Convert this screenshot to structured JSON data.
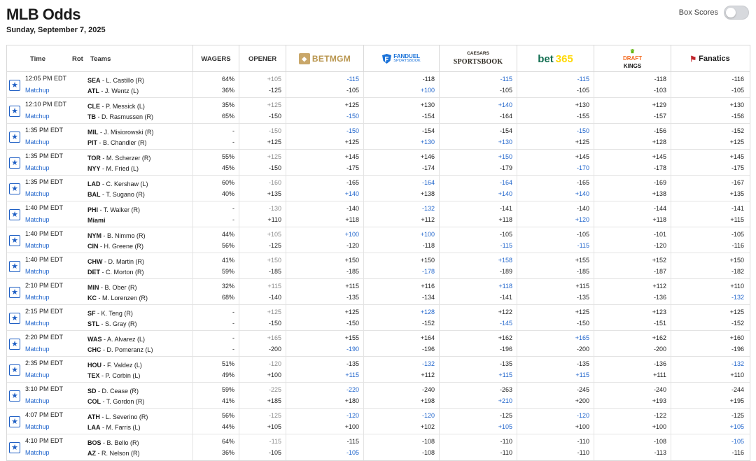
{
  "title": "MLB Odds",
  "date": "Sunday, September 7, 2025",
  "box_scores_label": "Box Scores",
  "columns": {
    "time": "Time",
    "rot": "Rot",
    "teams": "Teams",
    "wagers": "WAGERS",
    "opener": "OPENER"
  },
  "books": {
    "betmgm": "BETMGM",
    "fanduel_1": "FANDUEL",
    "fanduel_2": "SPORTSBOOK",
    "caesars_1": "CAESARS",
    "caesars_2": "SPORTSBOOK",
    "bet365_a": "bet",
    "bet365_b": "365",
    "dk_1": "DRAFT",
    "dk_2": "KINGS",
    "fanatics": "Fanatics"
  },
  "matchup_label": "Matchup",
  "games": [
    {
      "time": "12:05 PM EDT",
      "t1": "SEA",
      "p1": "L. Castillo (R)",
      "t2": "ATL",
      "p2": "J. Wentz (L)",
      "w": [
        "64%",
        "36%"
      ],
      "open": [
        "+105",
        "-125"
      ],
      "odds": [
        [
          "-115",
          "-105"
        ],
        [
          "-118",
          "+100"
        ],
        [
          "-115",
          "-105"
        ],
        [
          "-115",
          "-105"
        ],
        [
          "-118",
          "-103"
        ],
        [
          "-116",
          "-105"
        ]
      ],
      "blue": [
        [
          1,
          0
        ],
        [
          0,
          1
        ],
        [
          1,
          0
        ],
        [
          1,
          0
        ],
        [
          0,
          0
        ],
        [
          0,
          0
        ]
      ]
    },
    {
      "time": "12:10 PM EDT",
      "t1": "CLE",
      "p1": "P. Messick (L)",
      "t2": "TB",
      "p2": "D. Rasmussen (R)",
      "w": [
        "35%",
        "65%"
      ],
      "open": [
        "+125",
        "-150"
      ],
      "odds": [
        [
          "+125",
          "-150"
        ],
        [
          "+130",
          "-154"
        ],
        [
          "+140",
          "-164"
        ],
        [
          "+130",
          "-155"
        ],
        [
          "+129",
          "-157"
        ],
        [
          "+130",
          "-156"
        ]
      ],
      "blue": [
        [
          0,
          1
        ],
        [
          0,
          0
        ],
        [
          1,
          0
        ],
        [
          0,
          0
        ],
        [
          0,
          0
        ],
        [
          0,
          0
        ]
      ]
    },
    {
      "time": "1:35 PM EDT",
      "t1": "MIL",
      "p1": "J. Misiorowski (R)",
      "t2": "PIT",
      "p2": "B. Chandler (R)",
      "w": [
        "-",
        "-"
      ],
      "open": [
        "-150",
        "+125"
      ],
      "odds": [
        [
          "-150",
          "+125"
        ],
        [
          "-154",
          "+130"
        ],
        [
          "-154",
          "+130"
        ],
        [
          "-150",
          "+125"
        ],
        [
          "-156",
          "+128"
        ],
        [
          "-152",
          "+125"
        ]
      ],
      "blue": [
        [
          1,
          0
        ],
        [
          0,
          1
        ],
        [
          0,
          1
        ],
        [
          1,
          0
        ],
        [
          0,
          0
        ],
        [
          0,
          0
        ]
      ]
    },
    {
      "time": "1:35 PM EDT",
      "t1": "TOR",
      "p1": "M. Scherzer (R)",
      "t2": "NYY",
      "p2": "M. Fried (L)",
      "w": [
        "55%",
        "45%"
      ],
      "open": [
        "+125",
        "-150"
      ],
      "odds": [
        [
          "+145",
          "-175"
        ],
        [
          "+146",
          "-174"
        ],
        [
          "+150",
          "-179"
        ],
        [
          "+145",
          "-170"
        ],
        [
          "+145",
          "-178"
        ],
        [
          "+145",
          "-175"
        ]
      ],
      "blue": [
        [
          0,
          0
        ],
        [
          0,
          0
        ],
        [
          1,
          0
        ],
        [
          0,
          1
        ],
        [
          0,
          0
        ],
        [
          0,
          0
        ]
      ]
    },
    {
      "time": "1:35 PM EDT",
      "t1": "LAD",
      "p1": "C. Kershaw (L)",
      "t2": "BAL",
      "p2": "T. Sugano (R)",
      "w": [
        "60%",
        "40%"
      ],
      "open": [
        "-160",
        "+135"
      ],
      "odds": [
        [
          "-165",
          "+140"
        ],
        [
          "-164",
          "+138"
        ],
        [
          "-164",
          "+140"
        ],
        [
          "-165",
          "+140"
        ],
        [
          "-169",
          "+138"
        ],
        [
          "-167",
          "+135"
        ]
      ],
      "blue": [
        [
          0,
          1
        ],
        [
          1,
          0
        ],
        [
          1,
          1
        ],
        [
          0,
          1
        ],
        [
          0,
          0
        ],
        [
          0,
          0
        ]
      ]
    },
    {
      "time": "1:40 PM EDT",
      "t1": "PHI",
      "p1": "T. Walker (R)",
      "t2": "",
      "p2": "Miami",
      "w": [
        "-",
        "-"
      ],
      "open": [
        "-130",
        "+110"
      ],
      "odds": [
        [
          "-140",
          "+118"
        ],
        [
          "-132",
          "+112"
        ],
        [
          "-141",
          "+118"
        ],
        [
          "-140",
          "+120"
        ],
        [
          "-144",
          "+118"
        ],
        [
          "-141",
          "+115"
        ]
      ],
      "blue": [
        [
          0,
          0
        ],
        [
          1,
          0
        ],
        [
          0,
          0
        ],
        [
          0,
          1
        ],
        [
          0,
          0
        ],
        [
          0,
          0
        ]
      ]
    },
    {
      "time": "1:40 PM EDT",
      "t1": "NYM",
      "p1": "B. Nimmo (R)",
      "t2": "CIN",
      "p2": "H. Greene (R)",
      "w": [
        "44%",
        "56%"
      ],
      "open": [
        "+105",
        "-125"
      ],
      "odds": [
        [
          "+100",
          "-120"
        ],
        [
          "+100",
          "-118"
        ],
        [
          "-105",
          "-115"
        ],
        [
          "-105",
          "-115"
        ],
        [
          "-101",
          "-120"
        ],
        [
          "-105",
          "-116"
        ]
      ],
      "blue": [
        [
          1,
          0
        ],
        [
          1,
          0
        ],
        [
          0,
          1
        ],
        [
          0,
          1
        ],
        [
          0,
          0
        ],
        [
          0,
          0
        ]
      ]
    },
    {
      "time": "1:40 PM EDT",
      "t1": "CHW",
      "p1": "D. Martin (R)",
      "t2": "DET",
      "p2": "C. Morton (R)",
      "w": [
        "41%",
        "59%"
      ],
      "open": [
        "+150",
        "-185"
      ],
      "odds": [
        [
          "+150",
          "-185"
        ],
        [
          "+150",
          "-178"
        ],
        [
          "+158",
          "-189"
        ],
        [
          "+155",
          "-185"
        ],
        [
          "+152",
          "-187"
        ],
        [
          "+150",
          "-182"
        ]
      ],
      "blue": [
        [
          0,
          0
        ],
        [
          0,
          1
        ],
        [
          1,
          0
        ],
        [
          0,
          0
        ],
        [
          0,
          0
        ],
        [
          0,
          0
        ]
      ]
    },
    {
      "time": "2:10 PM EDT",
      "t1": "MIN",
      "p1": "B. Ober (R)",
      "t2": "KC",
      "p2": "M. Lorenzen (R)",
      "w": [
        "32%",
        "68%"
      ],
      "open": [
        "+115",
        "-140"
      ],
      "odds": [
        [
          "+115",
          "-135"
        ],
        [
          "+116",
          "-134"
        ],
        [
          "+118",
          "-141"
        ],
        [
          "+115",
          "-135"
        ],
        [
          "+112",
          "-136"
        ],
        [
          "+110",
          "-132"
        ]
      ],
      "blue": [
        [
          0,
          0
        ],
        [
          0,
          0
        ],
        [
          1,
          0
        ],
        [
          0,
          0
        ],
        [
          0,
          0
        ],
        [
          0,
          1
        ]
      ]
    },
    {
      "time": "2:15 PM EDT",
      "t1": "SF",
      "p1": "K. Teng (R)",
      "t2": "STL",
      "p2": "S. Gray (R)",
      "w": [
        "-",
        "-"
      ],
      "open": [
        "+125",
        "-150"
      ],
      "odds": [
        [
          "+125",
          "-150"
        ],
        [
          "+128",
          "-152"
        ],
        [
          "+122",
          "-145"
        ],
        [
          "+125",
          "-150"
        ],
        [
          "+123",
          "-151"
        ],
        [
          "+125",
          "-152"
        ]
      ],
      "blue": [
        [
          0,
          0
        ],
        [
          1,
          0
        ],
        [
          0,
          1
        ],
        [
          0,
          0
        ],
        [
          0,
          0
        ],
        [
          0,
          0
        ]
      ]
    },
    {
      "time": "2:20 PM EDT",
      "t1": "WAS",
      "p1": "A. Alvarez (L)",
      "t2": "CHC",
      "p2": "D. Pomeranz (L)",
      "w": [
        "-",
        "-"
      ],
      "open": [
        "+165",
        "-200"
      ],
      "odds": [
        [
          "+155",
          "-190"
        ],
        [
          "+164",
          "-196"
        ],
        [
          "+162",
          "-196"
        ],
        [
          "+165",
          "-200"
        ],
        [
          "+162",
          "-200"
        ],
        [
          "+160",
          "-196"
        ]
      ],
      "blue": [
        [
          0,
          1
        ],
        [
          0,
          0
        ],
        [
          0,
          0
        ],
        [
          1,
          0
        ],
        [
          0,
          0
        ],
        [
          0,
          0
        ]
      ]
    },
    {
      "time": "2:35 PM EDT",
      "t1": "HOU",
      "p1": "F. Valdez (L)",
      "t2": "TEX",
      "p2": "P. Corbin (L)",
      "w": [
        "51%",
        "49%"
      ],
      "open": [
        "-120",
        "+100"
      ],
      "odds": [
        [
          "-135",
          "+115"
        ],
        [
          "-132",
          "+112"
        ],
        [
          "-135",
          "+115"
        ],
        [
          "-135",
          "+115"
        ],
        [
          "-136",
          "+111"
        ],
        [
          "-132",
          "+110"
        ]
      ],
      "blue": [
        [
          0,
          1
        ],
        [
          1,
          0
        ],
        [
          0,
          1
        ],
        [
          0,
          1
        ],
        [
          0,
          0
        ],
        [
          1,
          0
        ]
      ]
    },
    {
      "time": "3:10 PM EDT",
      "t1": "SD",
      "p1": "D. Cease (R)",
      "t2": "COL",
      "p2": "T. Gordon (R)",
      "w": [
        "59%",
        "41%"
      ],
      "open": [
        "-225",
        "+185"
      ],
      "odds": [
        [
          "-220",
          "+180"
        ],
        [
          "-240",
          "+198"
        ],
        [
          "-263",
          "+210"
        ],
        [
          "-245",
          "+200"
        ],
        [
          "-240",
          "+193"
        ],
        [
          "-244",
          "+195"
        ]
      ],
      "blue": [
        [
          1,
          0
        ],
        [
          0,
          0
        ],
        [
          0,
          1
        ],
        [
          0,
          0
        ],
        [
          0,
          0
        ],
        [
          0,
          0
        ]
      ]
    },
    {
      "time": "4:07 PM EDT",
      "t1": "ATH",
      "p1": "L. Severino (R)",
      "t2": "LAA",
      "p2": "M. Farris (L)",
      "w": [
        "56%",
        "44%"
      ],
      "open": [
        "-125",
        "+105"
      ],
      "odds": [
        [
          "-120",
          "+100"
        ],
        [
          "-120",
          "+102"
        ],
        [
          "-125",
          "+105"
        ],
        [
          "-120",
          "+100"
        ],
        [
          "-122",
          "+100"
        ],
        [
          "-125",
          "+105"
        ]
      ],
      "blue": [
        [
          1,
          0
        ],
        [
          1,
          0
        ],
        [
          0,
          1
        ],
        [
          1,
          0
        ],
        [
          0,
          0
        ],
        [
          0,
          1
        ]
      ]
    },
    {
      "time": "4:10 PM EDT",
      "t1": "BOS",
      "p1": "B. Bello (R)",
      "t2": "AZ",
      "p2": "R. Nelson (R)",
      "w": [
        "64%",
        "36%"
      ],
      "open": [
        "-115",
        "-105"
      ],
      "odds": [
        [
          "-115",
          "-105"
        ],
        [
          "-108",
          "-108"
        ],
        [
          "-110",
          "-110"
        ],
        [
          "-110",
          "-110"
        ],
        [
          "-108",
          "-113"
        ],
        [
          "-105",
          "-116"
        ]
      ],
      "blue": [
        [
          0,
          1
        ],
        [
          0,
          0
        ],
        [
          0,
          0
        ],
        [
          0,
          0
        ],
        [
          0,
          0
        ],
        [
          1,
          0
        ]
      ]
    }
  ]
}
